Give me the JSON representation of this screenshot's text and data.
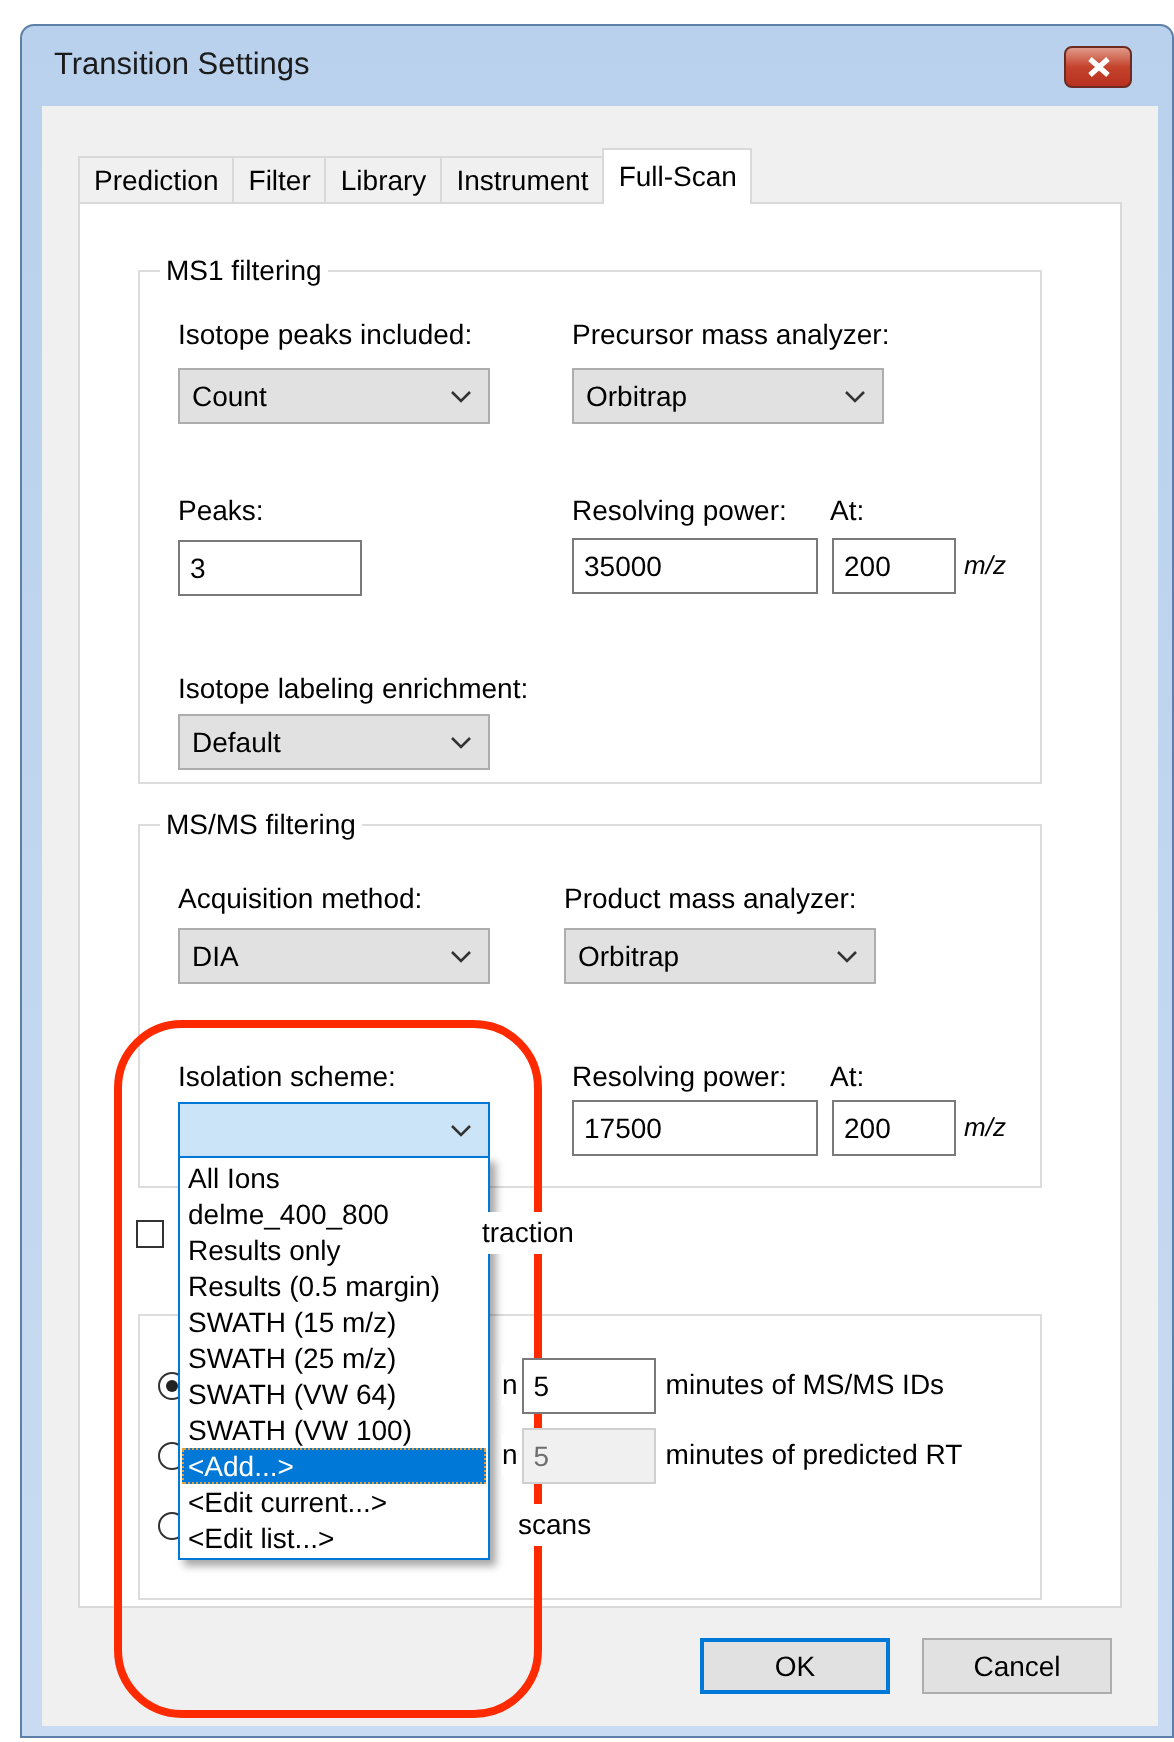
{
  "window": {
    "title": "Transition Settings"
  },
  "tabs": [
    {
      "label": "Prediction",
      "selected": false
    },
    {
      "label": "Filter",
      "selected": false
    },
    {
      "label": "Library",
      "selected": false
    },
    {
      "label": "Instrument",
      "selected": false
    },
    {
      "label": "Full-Scan",
      "selected": true
    }
  ],
  "ms1_filtering": {
    "title": "MS1 filtering",
    "isotope_peaks_included": {
      "label": "Isotope peaks included:",
      "value": "Count"
    },
    "precursor_mass_analyzer": {
      "label": "Precursor mass analyzer:",
      "value": "Orbitrap"
    },
    "peaks": {
      "label": "Peaks:",
      "value": "3"
    },
    "resolving_power": {
      "label": "Resolving power:",
      "value": "35000"
    },
    "at": {
      "label": "At:",
      "value": "200",
      "unit": "m/z"
    },
    "isotope_labeling_enrichment": {
      "label": "Isotope labeling enrichment:",
      "value": "Default"
    }
  },
  "msms_filtering": {
    "title": "MS/MS filtering",
    "acquisition_method": {
      "label": "Acquisition method:",
      "value": "DIA"
    },
    "product_mass_analyzer": {
      "label": "Product mass analyzer:",
      "value": "Orbitrap"
    },
    "isolation_scheme": {
      "label": "Isolation scheme:",
      "expanded": true,
      "options": [
        {
          "label": "All Ions",
          "selected": false
        },
        {
          "label": "delme_400_800",
          "selected": false
        },
        {
          "label": "Results only",
          "selected": false
        },
        {
          "label": "Results (0.5 margin)",
          "selected": false
        },
        {
          "label": "SWATH (15 m/z)",
          "selected": false
        },
        {
          "label": "SWATH (25 m/z)",
          "selected": false
        },
        {
          "label": "SWATH (VW 64)",
          "selected": false
        },
        {
          "label": "SWATH (VW 100)",
          "selected": false
        },
        {
          "label": "<Add...>",
          "selected": true
        },
        {
          "label": "<Edit current...>",
          "selected": false
        },
        {
          "label": "<Edit list...>",
          "selected": false
        }
      ]
    },
    "resolving_power": {
      "label": "Resolving power:",
      "value": "17500"
    },
    "at": {
      "label": "At:",
      "value": "200",
      "unit": "m/z"
    }
  },
  "checkbox": {
    "label": "traction",
    "checked": false
  },
  "retention_time_filtering": {
    "options": [
      {
        "label": "n",
        "selected": true,
        "value": "5",
        "disabled": false,
        "suffix": "minutes of MS/MS IDs"
      },
      {
        "label": "n",
        "selected": false,
        "value": "5",
        "disabled": true,
        "suffix": "minutes of predicted RT"
      },
      {
        "label": "scans",
        "selected": false
      }
    ]
  },
  "buttons": [
    {
      "label": "OK",
      "default": true
    },
    {
      "label": "Cancel",
      "default": false
    }
  ],
  "annotation": {
    "kind": "rounded-outline",
    "color": "#ff2a00"
  }
}
